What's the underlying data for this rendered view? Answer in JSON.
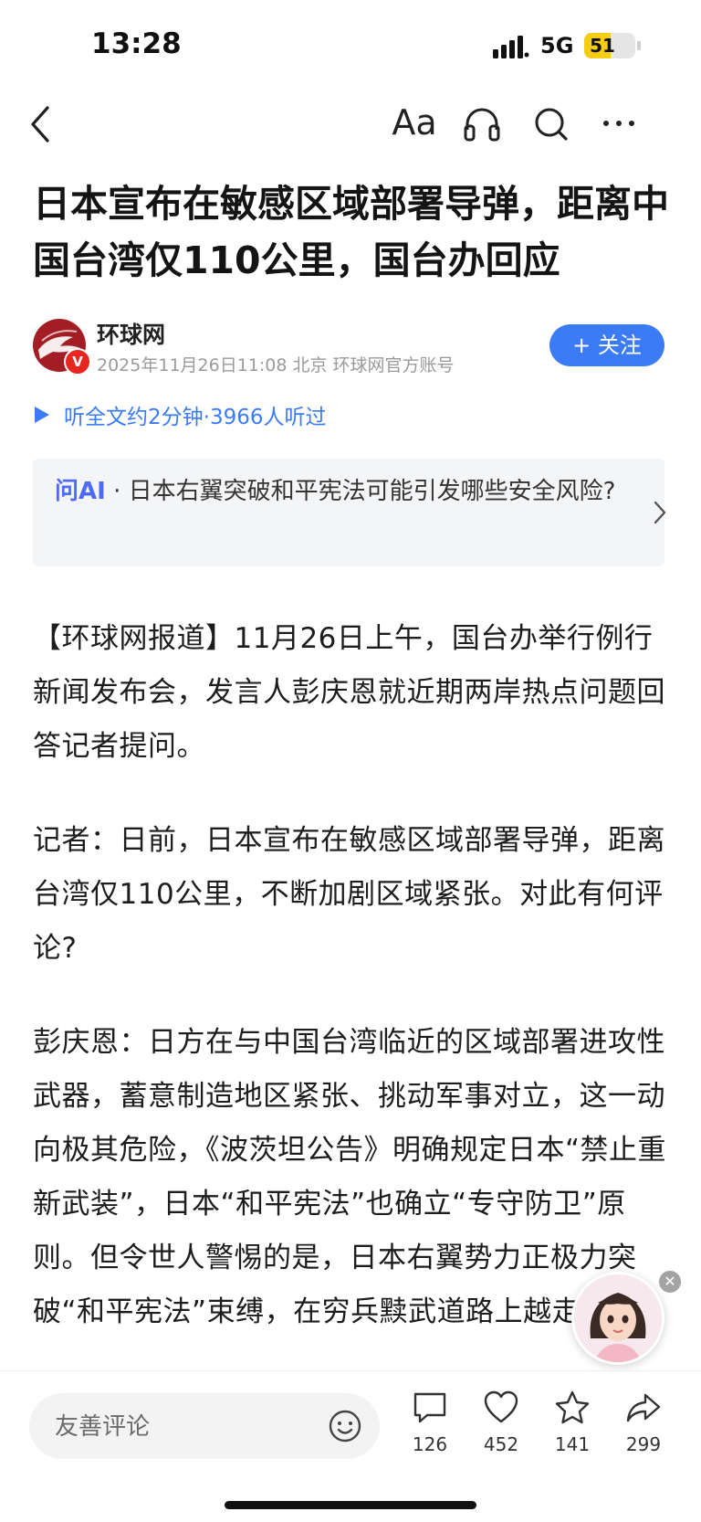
{
  "status_bar": {
    "time": "13:28",
    "network": "5G",
    "battery": "51",
    "battery_level": 0.51,
    "battery_color": "#f5cc16"
  },
  "nav": {
    "back_icon": "back-chevron-icon",
    "font_size_label": "Aa",
    "listen_icon": "headphones-icon",
    "search_icon": "search-icon",
    "more_icon": "more-dots-icon"
  },
  "article": {
    "title": "日本宣布在敏感区域部署导弹，距离中国台湾仅110公里，国台办回应",
    "author": {
      "name": "环球网",
      "meta": "2025年11月26日11:08 北京 环球网官方账号",
      "verified_badge": "V",
      "follow_label": "+ 关注"
    },
    "listen_text": "听全文约2分钟·3966人听过",
    "ask_ai": {
      "label": "问AI",
      "separator": "·",
      "question": "日本右翼突破和平宪法可能引发哪些安全风险?"
    },
    "paragraphs": [
      "【环球网报道】11月26日上午，国台办举行例行新闻发布会，发言人彭庆恩就近期两岸热点问题回答记者提问。",
      "记者：日前，日本宣布在敏感区域部署导弹，距离台湾仅110公里，不断加剧区域紧张。对此有何评论?",
      "彭庆恩：日方在与中国台湾临近的区域部署进攻性武器，蓄意制造地区紧张、挑动军事对立，这一动向极其危险，《波茨坦公告》明确规定日本“禁止重新武装”，日本“和平宪法”也确立“专守防卫”原则。但令世人警惕的是，日本右翼势力正极力突破“和平宪法”束缚，在穷兵黩武道路上越走越远，"
    ]
  },
  "bottom_bar": {
    "comment_placeholder": "友善评论",
    "comments": "126",
    "likes": "452",
    "favorites": "141",
    "shares": "299"
  },
  "colors": {
    "accent": "#3c7bf6",
    "ai_label": "#4f6bf5",
    "brand_red": "#a31d24"
  }
}
